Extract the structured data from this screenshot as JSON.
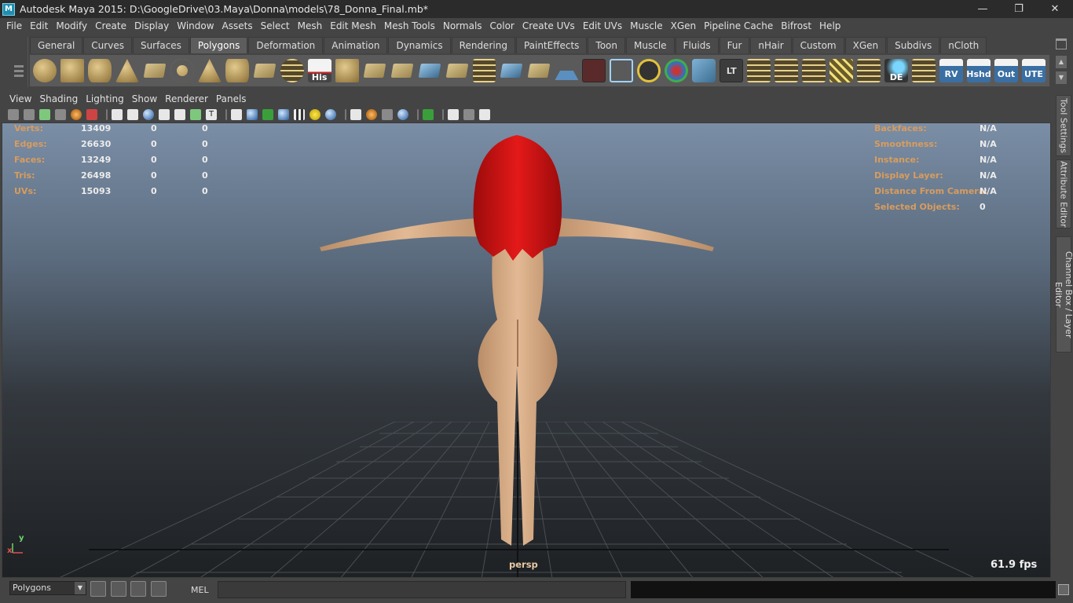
{
  "window": {
    "title": "Autodesk Maya 2015: D:\\GoogleDrive\\03.Maya\\Donna\\models\\78_Donna_Final.mb*",
    "app_icon": "M",
    "buttons": [
      "—",
      "❐",
      "✕"
    ]
  },
  "main_menu": [
    "File",
    "Edit",
    "Modify",
    "Create",
    "Display",
    "Window",
    "Assets",
    "Select",
    "Mesh",
    "Edit Mesh",
    "Mesh Tools",
    "Normals",
    "Color",
    "Create UVs",
    "Edit UVs",
    "Muscle",
    "XGen",
    "Pipeline Cache",
    "Bifrost",
    "Help"
  ],
  "shelf": {
    "tabs": [
      "General",
      "Curves",
      "Surfaces",
      "Polygons",
      "Deformation",
      "Animation",
      "Dynamics",
      "Rendering",
      "PaintEffects",
      "Toon",
      "Muscle",
      "Fluids",
      "Fur",
      "nHair",
      "Custom",
      "XGen",
      "Subdivs",
      "nCloth"
    ],
    "active_tab": "Polygons",
    "icon_labels": {
      "his": "His",
      "lt": "LT",
      "de": "DE",
      "rv": "RV",
      "hshd": "Hshd",
      "out": "Out",
      "ute": "UTE"
    }
  },
  "panel_menu": [
    "View",
    "Shading",
    "Lighting",
    "Show",
    "Renderer",
    "Panels"
  ],
  "hud_left": [
    {
      "label": "Verts:",
      "v1": "13409",
      "v2": "0",
      "v3": "0"
    },
    {
      "label": "Edges:",
      "v1": "26630",
      "v2": "0",
      "v3": "0"
    },
    {
      "label": "Faces:",
      "v1": "13249",
      "v2": "0",
      "v3": "0"
    },
    {
      "label": "Tris:",
      "v1": "26498",
      "v2": "0",
      "v3": "0"
    },
    {
      "label": "UVs:",
      "v1": "15093",
      "v2": "0",
      "v3": "0"
    }
  ],
  "hud_right": [
    {
      "label": "Backfaces:",
      "value": "N/A"
    },
    {
      "label": "Smoothness:",
      "value": "N/A"
    },
    {
      "label": "Instance:",
      "value": "N/A"
    },
    {
      "label": "Display Layer:",
      "value": "N/A"
    },
    {
      "label": "Distance From Camera:",
      "value": "N/A"
    },
    {
      "label": "Selected Objects:",
      "value": "0"
    }
  ],
  "viewport": {
    "camera": "persp",
    "fps": "61.9 fps",
    "axis_x": "x",
    "axis_y": "y"
  },
  "dock_tabs": [
    "Tool Settings",
    "Attribute Editor",
    "Channel Box / Layer Editor"
  ],
  "command_line": {
    "mode": "Polygons",
    "language": "MEL"
  }
}
